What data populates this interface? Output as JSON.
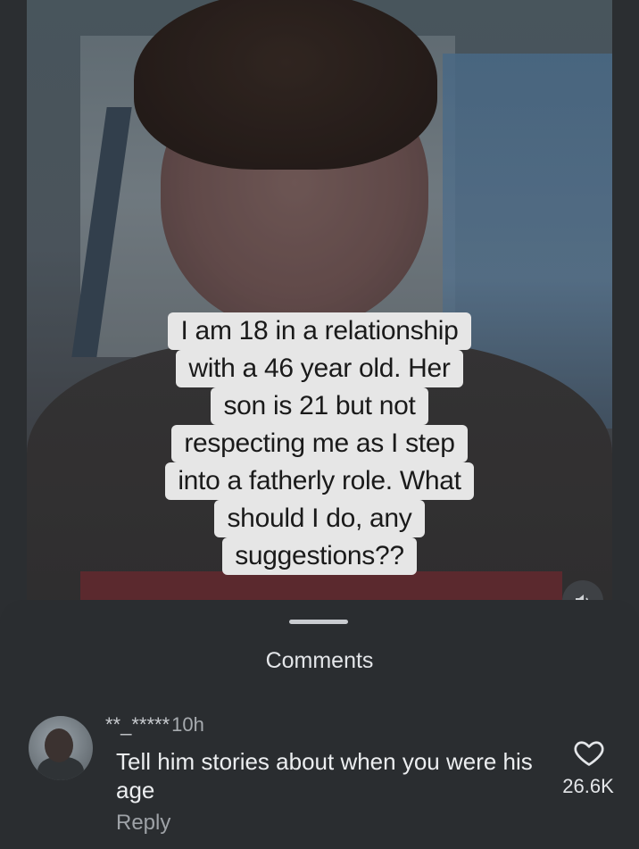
{
  "video": {
    "caption_lines": [
      "I am 18 in a relationship",
      "with a 46 year old. Her",
      "son is 21 but not",
      "respecting me as I step",
      "into a fatherly role. What",
      "should I do, any",
      "suggestions??"
    ],
    "mute_icon": "speaker-icon"
  },
  "comments": {
    "title": "Comments",
    "items": [
      {
        "username": "**_*****",
        "time": "10h",
        "text": "Tell him stories about when you were his age",
        "reply_label": "Reply",
        "likes": "26.6K",
        "like_icon": "heart-icon"
      }
    ]
  }
}
